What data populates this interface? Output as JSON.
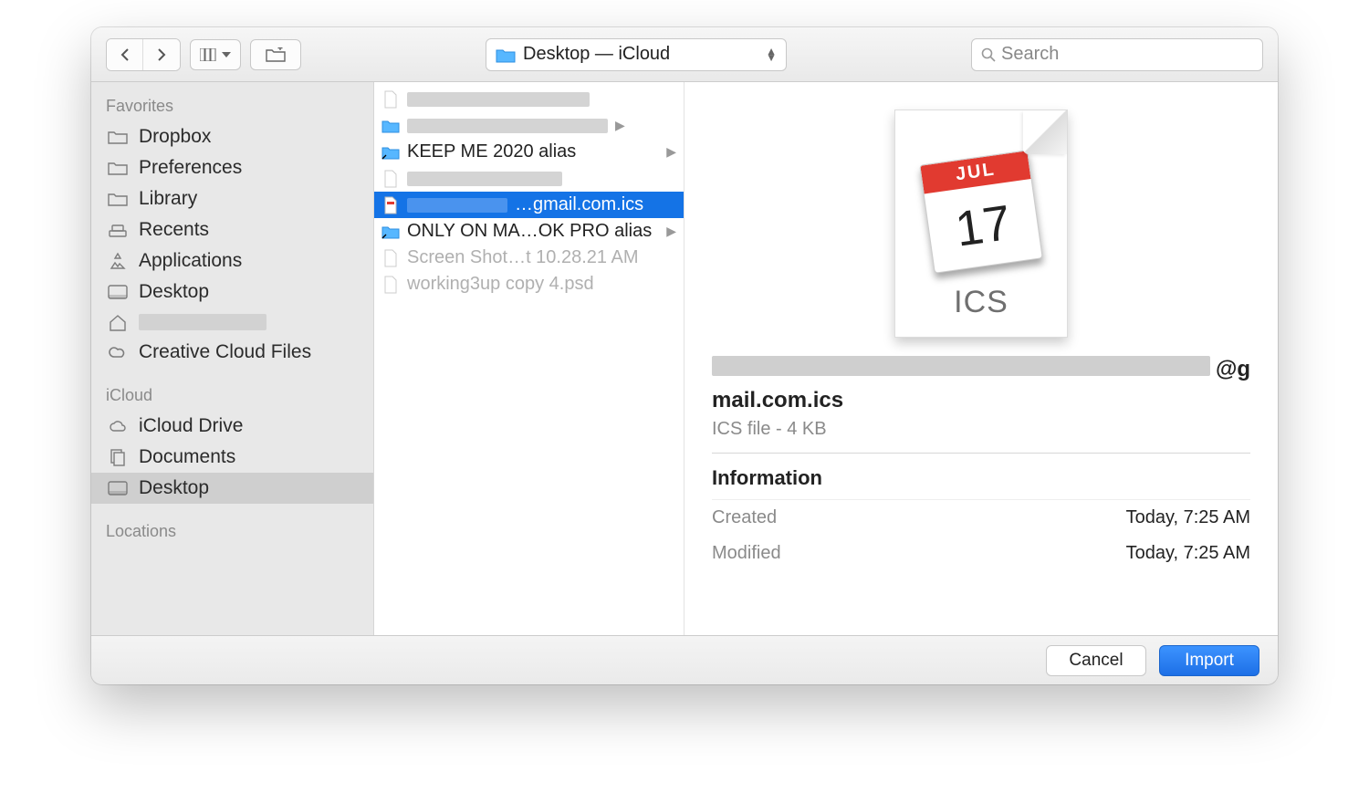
{
  "toolbar": {
    "path_label": "Desktop — iCloud",
    "search_placeholder": "Search"
  },
  "sidebar": {
    "sections": [
      {
        "header": "Favorites",
        "items": [
          {
            "label": "Dropbox",
            "icon": "folder"
          },
          {
            "label": "Preferences",
            "icon": "folder"
          },
          {
            "label": "Library",
            "icon": "folder"
          },
          {
            "label": "Recents",
            "icon": "recents"
          },
          {
            "label": "Applications",
            "icon": "applications"
          },
          {
            "label": "Desktop",
            "icon": "desktop"
          },
          {
            "label": "",
            "icon": "home",
            "redacted": true
          },
          {
            "label": "Creative Cloud Files",
            "icon": "cc"
          }
        ]
      },
      {
        "header": "iCloud",
        "items": [
          {
            "label": "iCloud Drive",
            "icon": "cloud"
          },
          {
            "label": "Documents",
            "icon": "documents"
          },
          {
            "label": "Desktop",
            "icon": "desktop",
            "selected": true
          }
        ]
      },
      {
        "header": "Locations",
        "items": []
      }
    ]
  },
  "filelist": [
    {
      "label": "",
      "icon": "doc-light",
      "dim": true,
      "redacted": true,
      "redact_width": 200
    },
    {
      "label": "",
      "icon": "folder-blue",
      "chevron": true,
      "redacted": true,
      "redact_width": 220
    },
    {
      "label": "KEEP ME 2020 alias",
      "icon": "folder-blue-alias",
      "chevron": true
    },
    {
      "label": "",
      "icon": "doc-light",
      "dim": true,
      "redacted": true,
      "redact_width": 170
    },
    {
      "label": "…gmail.com.ics",
      "icon": "ics",
      "selected": true,
      "redacted_prefix": true,
      "prefix_redact_width": 110
    },
    {
      "label": "ONLY ON MA…OK PRO alias",
      "icon": "folder-blue-alias",
      "chevron": true
    },
    {
      "label": "Screen Shot…t 10.28.21 AM",
      "icon": "doc-light",
      "dim": true
    },
    {
      "label": "working3up copy 4.psd",
      "icon": "doc-light",
      "dim": true
    }
  ],
  "preview": {
    "calendar_month": "JUL",
    "calendar_day": "17",
    "ext_badge": "ICS",
    "filename_suffix_line1": "@g",
    "filename_suffix_line2": "mail.com.ics",
    "file_subtitle": "ICS file - 4 KB",
    "info_header": "Information",
    "created_label": "Created",
    "created_value": "Today, 7:25 AM",
    "modified_label": "Modified",
    "modified_value": "Today, 7:25 AM"
  },
  "footer": {
    "cancel": "Cancel",
    "import": "Import"
  }
}
